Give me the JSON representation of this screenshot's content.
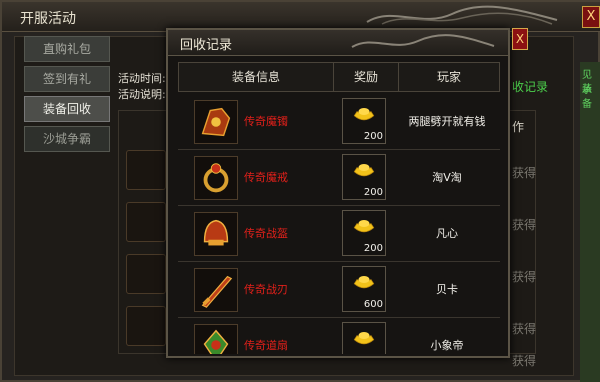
{
  "outer": {
    "title": "开服活动",
    "close_label": "X",
    "tabs": [
      {
        "label": "直购礼包"
      },
      {
        "label": "签到有礼"
      },
      {
        "label": "装备回收"
      },
      {
        "label": "沙城争霸"
      }
    ],
    "activity_time_label": "活动时间:",
    "activity_desc_label": "活动说明:",
    "record_link": "收记录",
    "bg_header_tail": "作",
    "bg_get_labels": [
      "获得",
      "获得",
      "获得",
      "获得",
      "获得"
    ],
    "right_strip_texts": [
      "见承",
      "装备"
    ]
  },
  "popup": {
    "title": "回收记录",
    "close_label": "X",
    "headers": {
      "item": "装备信息",
      "reward": "奖励",
      "player": "玩家"
    },
    "rows": [
      {
        "icon": "armor-icon",
        "name": "传奇魔镯",
        "reward_icon": "gold-ingot-icon",
        "reward": "200",
        "player": "两腿劈开就有钱"
      },
      {
        "icon": "ring-icon",
        "name": "传奇魔戒",
        "reward_icon": "gold-ingot-icon",
        "reward": "200",
        "player": "淘V淘"
      },
      {
        "icon": "helmet-icon",
        "name": "传奇战盔",
        "reward_icon": "gold-ingot-icon",
        "reward": "200",
        "player": "凡心"
      },
      {
        "icon": "blade-icon",
        "name": "传奇战刃",
        "reward_icon": "gold-ingot-icon",
        "reward": "600",
        "player": "贝卡"
      },
      {
        "icon": "amulet-icon",
        "name": "传奇道扇",
        "reward_icon": "gold-ingot-icon",
        "reward": "",
        "player": "小象帝"
      }
    ]
  },
  "colors": {
    "item_name": "#e0201a",
    "accent_gold": "#d4a84a",
    "green_text": "#4cd04c"
  }
}
